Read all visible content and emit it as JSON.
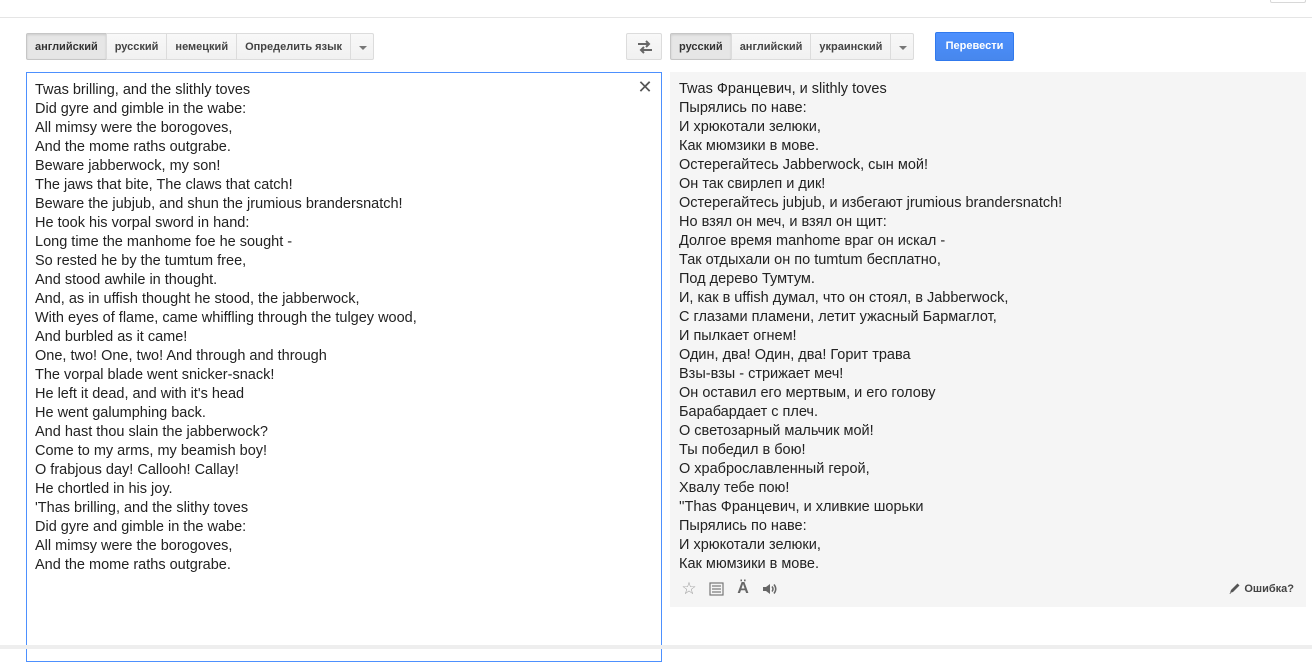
{
  "source_languages": {
    "items": [
      "английский",
      "русский",
      "немецкий",
      "Определить язык"
    ],
    "selected_index": 0
  },
  "target_languages": {
    "items": [
      "русский",
      "английский",
      "украинский"
    ],
    "selected_index": 0
  },
  "icons": {
    "swap": "swap-arrows-icon",
    "dropdown": "chevron-down-icon",
    "clear": "close-icon",
    "star": "star-icon",
    "dictionary": "dictionary-icon",
    "romanization": "transliteration-icon",
    "listen": "speaker-icon",
    "report": "pencil-icon"
  },
  "translate_button": "Перевести",
  "clear_glyph": "✕",
  "source_lines": [
    "Twas brilling, and the slithly toves",
    "Did gyre and gimble in the wabe:",
    "All mimsy were the borogoves,",
    "And the mome raths outgrabe.",
    "Beware jabberwock, my son!",
    "The jaws that bite, The claws that catch!",
    "Beware the jubjub, and shun the jrumious brandersnatch!",
    "He took his vorpal sword in hand:",
    "Long time the manhome foe he sought -",
    "So rested he by the tumtum free,",
    "And stood awhile in thought.",
    "And, as in uffish thought he stood, the jabberwock,",
    "With eyes of flame, came whiffling through the tulgey wood,",
    "And burbled as it came!",
    "One, two! One, two! And through and through",
    "The vorpal blade went snicker-snack!",
    "He left it dead, and with it's head",
    "He went galumphing back.",
    "And hast thou slain the jabberwock?",
    "Come to my arms, my beamish boy!",
    "O frabjous day! Callooh! Callay!",
    "He chortled in his joy.",
    "'Thas brilling, and the slithy toves",
    "Did gyre and gimble in the wabe:",
    "All mimsy were the borogoves,",
    "And the mome raths outgrabe."
  ],
  "result_lines": [
    "Twas Францевич, и slithly toves",
    "Пырялись по наве:",
    "И хрюкотали зелюки,",
    "Как мюмзики в мове.",
    "Остерегайтесь Jabberwock, сын мой!",
    "Он так свирлеп и дик!",
    "Остерегайтесь jubjub, и избегают jrumious brandersnatch!",
    "Но взял он меч, и взял он щит:",
    "Долгое время manhome враг он искал -",
    "Так отдыхали он по tumtum бесплатно,",
    "Под дерево Тумтум.",
    "И, как в uffish думал, что он стоял, в Jabberwock,",
    "С глазами пламени, летит ужасный Бармаглот,",
    "И пылкает огнем!",
    "Один, два! Один, два! Горит трава",
    "Взы-взы - стрижает меч!",
    "Он оставил его мертвым, и его голову",
    "Барабардает с плеч.",
    "О светозарный мальчик мой!",
    "Ты победил в бою!",
    "О храброславленный герой,",
    "Хвалу тебе пою!",
    "''Thas Францевич, и хливкие шорьки",
    "Пырялись по наве:",
    "И хрюкотали зелюки,",
    "Как мюмзики в мове."
  ],
  "tools": {
    "star_glyph": "☆",
    "aa_glyph": "Ä"
  },
  "report_label": "Ошибка?"
}
